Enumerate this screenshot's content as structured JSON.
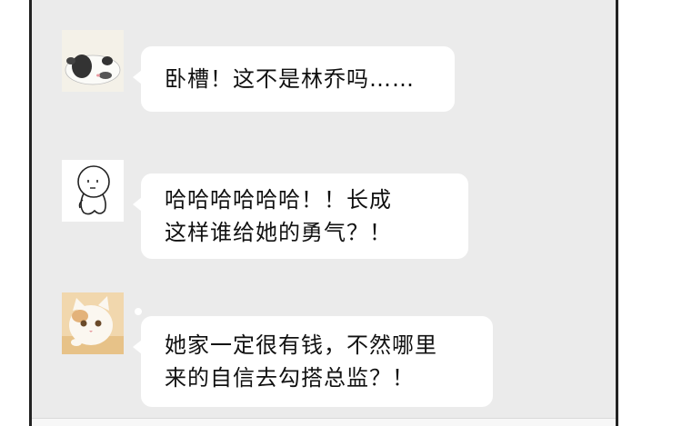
{
  "messages": [
    {
      "avatar": "panda-avatar",
      "text": "卧槽！这不是林乔吗……"
    },
    {
      "avatar": "stick-figure-avatar",
      "text": "哈哈哈哈哈哈！！长成\n这样谁给她的勇气？！"
    },
    {
      "avatar": "cat-avatar",
      "text": "她家一定很有钱，不然哪里\n来的自信去勾搭总监？！"
    }
  ],
  "colors": {
    "chat_bg": "#ebebeb",
    "bubble": "#ffffff",
    "text": "#111111"
  }
}
